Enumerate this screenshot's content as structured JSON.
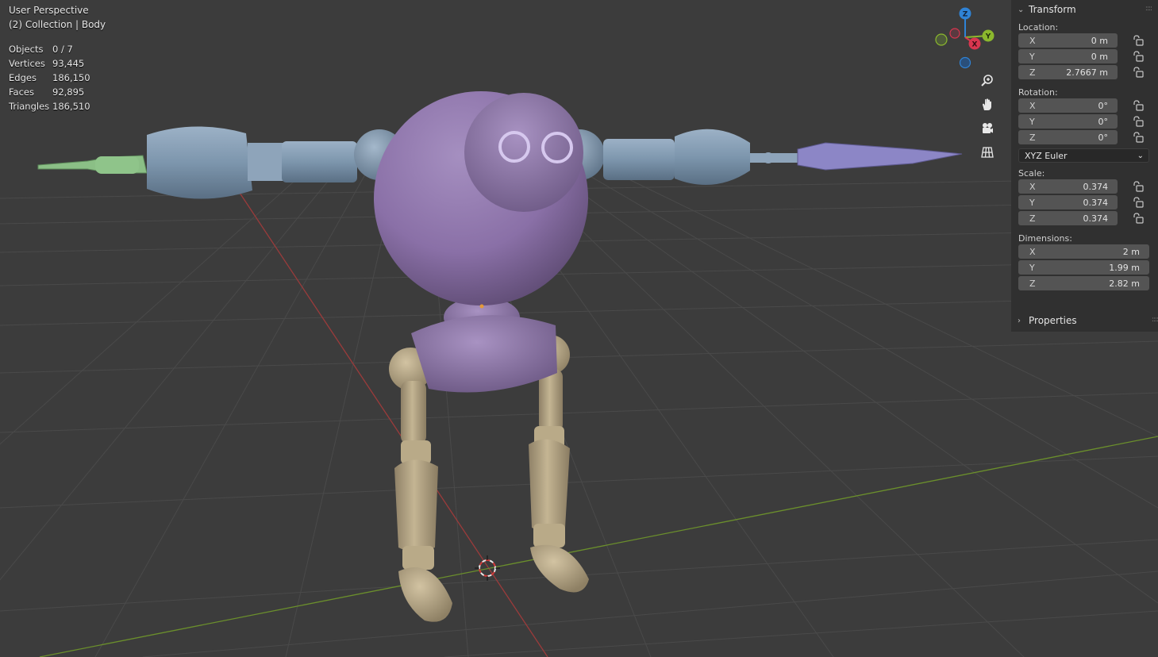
{
  "viewport": {
    "view_name": "User Perspective",
    "collection": "(2) Collection | Body",
    "stats": [
      {
        "label": "Objects",
        "value": "0 / 7"
      },
      {
        "label": "Vertices",
        "value": "93,445"
      },
      {
        "label": "Edges",
        "value": "186,150"
      },
      {
        "label": "Faces",
        "value": "92,895"
      },
      {
        "label": "Triangles",
        "value": "186,510"
      }
    ]
  },
  "gizmo": {
    "z": "Z",
    "y": "Y",
    "x": "X",
    "colors": {
      "x": "#d9364f",
      "y": "#8bb82d",
      "z": "#2f83d6"
    }
  },
  "nav_icons": [
    "zoom-icon",
    "hand-pan-icon",
    "camera-icon",
    "grid-perspective-icon"
  ],
  "panel": {
    "transform_title": "Transform",
    "location_label": "Location:",
    "location": [
      {
        "axis": "X",
        "value": "0 m"
      },
      {
        "axis": "Y",
        "value": "0 m"
      },
      {
        "axis": "Z",
        "value": "2.7667 m"
      }
    ],
    "rotation_label": "Rotation:",
    "rotation": [
      {
        "axis": "X",
        "value": "0°"
      },
      {
        "axis": "Y",
        "value": "0°"
      },
      {
        "axis": "Z",
        "value": "0°"
      }
    ],
    "rotation_mode": "XYZ Euler",
    "scale_label": "Scale:",
    "scale": [
      {
        "axis": "X",
        "value": "0.374"
      },
      {
        "axis": "Y",
        "value": "0.374"
      },
      {
        "axis": "Z",
        "value": "0.374"
      }
    ],
    "dimensions_label": "Dimensions:",
    "dimensions": [
      {
        "axis": "X",
        "value": "2 m"
      },
      {
        "axis": "Y",
        "value": "1.99 m"
      },
      {
        "axis": "Z",
        "value": "2.82 m"
      }
    ],
    "properties_title": "Properties"
  },
  "colors": {
    "background": "#3c3c3c",
    "panel": "#303030",
    "field": "#545454",
    "head": "#8e74a9",
    "limb_blue": "#7e97b0",
    "leg_tan": "#b3a383"
  }
}
